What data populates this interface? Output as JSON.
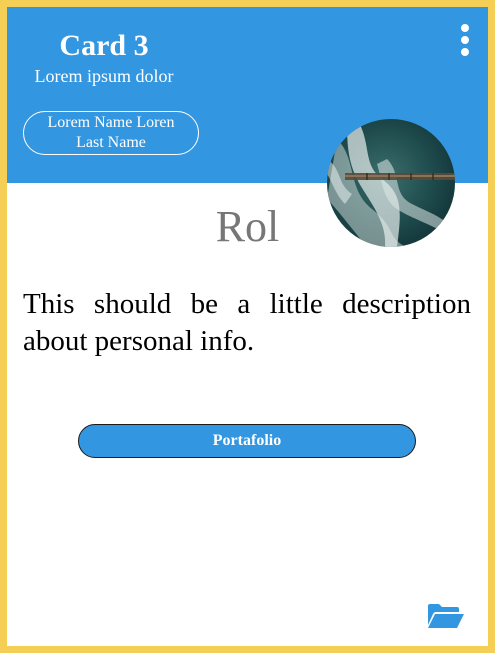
{
  "card": {
    "title": "Card 3",
    "subtitle": "Lorem ipsum dolor",
    "name_line1": "Lorem Name Loren",
    "name_line2": "Last Name",
    "role": "Rol",
    "description": "This should be a little description about personal info.",
    "portfolio_label": "Portafolio"
  },
  "icons": {
    "menu": "vertical-dots-icon",
    "folder": "folder-open-icon"
  },
  "colors": {
    "border": "#f5cf55",
    "accent": "#3396e0",
    "role_text": "#777777"
  }
}
